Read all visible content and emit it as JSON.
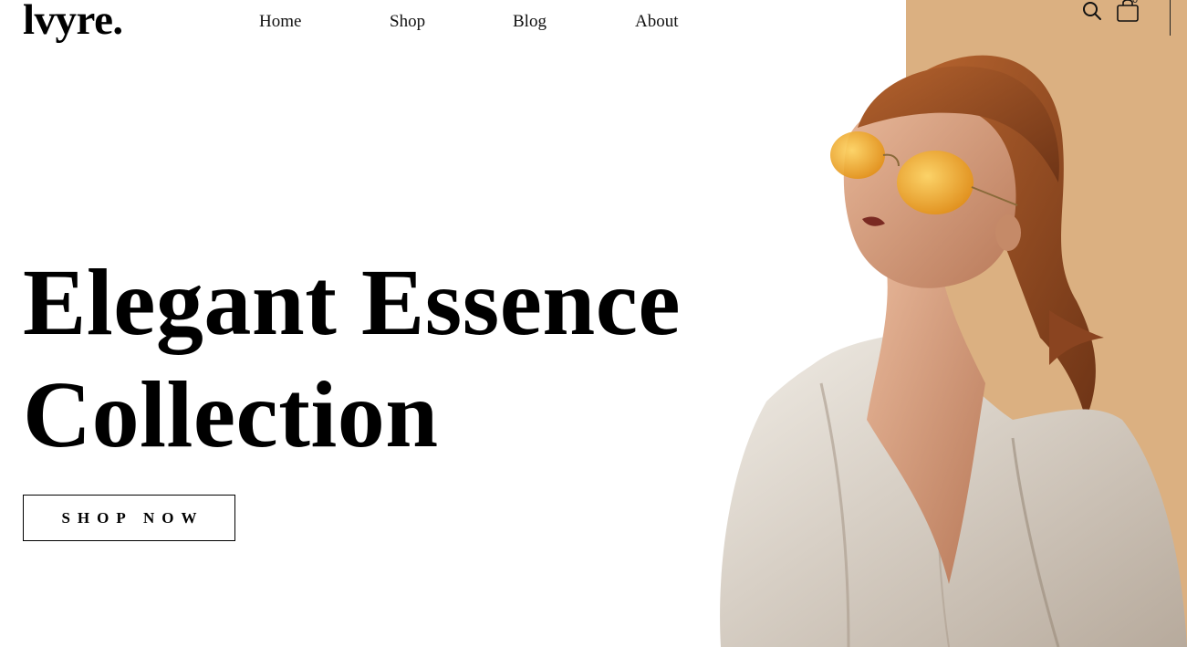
{
  "brand": {
    "logo_text": "lvyre."
  },
  "nav": {
    "items": [
      {
        "label": "Home"
      },
      {
        "label": "Shop"
      },
      {
        "label": "Blog"
      },
      {
        "label": "About"
      }
    ]
  },
  "header_icons": {
    "search_icon": "search-icon",
    "cart_icon": "shopping-bag-icon",
    "cart_count": "0"
  },
  "hero": {
    "title_line1": "Elegant Essence",
    "title_line2": "Collection",
    "cta_label": "SHOP NOW",
    "image": "woman-in-yellow-sunglasses-and-white-shirt"
  },
  "colors": {
    "accent_panel": "#dbb081",
    "text": "#000000",
    "background": "#ffffff"
  }
}
